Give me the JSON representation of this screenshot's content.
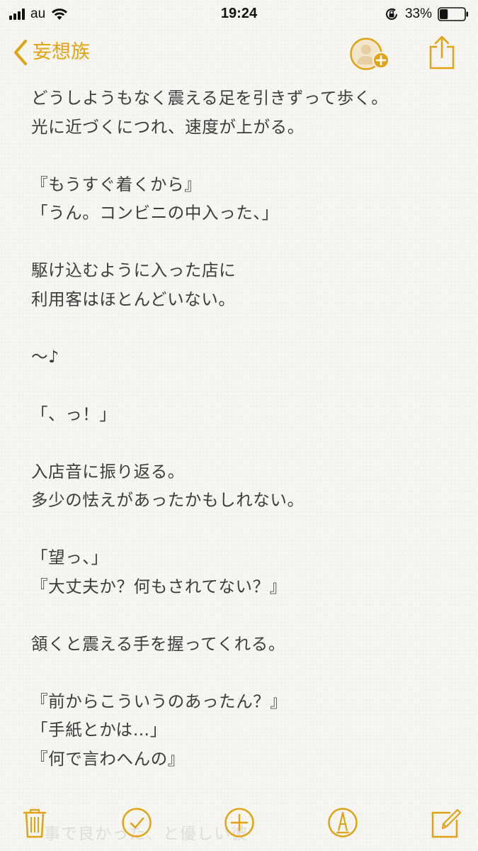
{
  "status_bar": {
    "carrier": "au",
    "time": "19:24",
    "battery_percent": "33%",
    "battery_level": 0.33,
    "icons": [
      "signal-icon",
      "wifi-icon",
      "rotation-lock-icon",
      "battery-icon"
    ]
  },
  "nav": {
    "back_label": "妄想族",
    "accent_color": "#e1a314",
    "icons": [
      "back-chevron-icon",
      "add-person-icon",
      "share-icon"
    ]
  },
  "note": {
    "lines": [
      "どうしようもなく震える足を引きずって歩く。",
      "光に近づくにつれ、速度が上がる。",
      "",
      "『もうすぐ着くから』",
      "「うん。コンビニの中入った、」",
      "",
      "駆け込むように入った店に",
      "利用客はほとんどいない。",
      "",
      "〜♪",
      "",
      "「、っ！」",
      "",
      "入店音に振り返る。",
      "多少の怯えがあったかもしれない。",
      "",
      "「望っ、」",
      "『大丈夫か？何もされてない？』",
      "",
      "頷くと震える手を握ってくれる。",
      "",
      "『前からこういうのあったん？』",
      "「手紙とかは…」",
      "『何で言わへんの』"
    ]
  },
  "toolbar": {
    "ghost_text": "事で良かった、と優しい彼",
    "icons": [
      "trash-icon",
      "checklist-icon",
      "add-icon",
      "markup-icon",
      "compose-icon"
    ]
  }
}
